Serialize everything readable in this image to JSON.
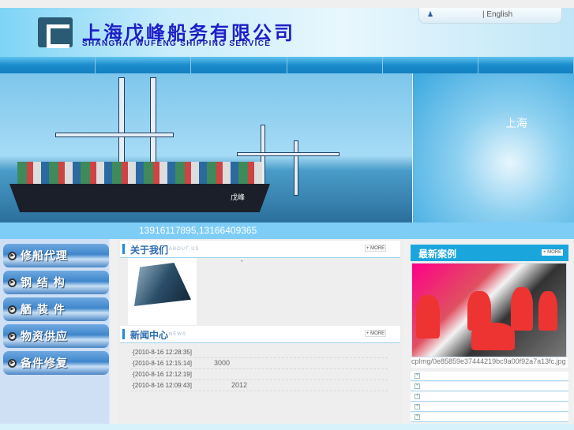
{
  "header": {
    "company_cn": "上海戊峰船务有限公司",
    "company_en": "SHANGHAI WUFENG SHIPPING SERVICE",
    "language_link": "| English",
    "user_icon": "user-icon"
  },
  "nav": {
    "items": [
      "",
      "",
      "",
      "",
      "",
      ""
    ]
  },
  "banner": {
    "ship_name": "戊峰",
    "globe_label": "上海"
  },
  "contact": {
    "phone": "13916117895,13166409365"
  },
  "sidebar": {
    "items": [
      {
        "label": "修船代理"
      },
      {
        "label": "钢 结 构"
      },
      {
        "label": "舾 装 件"
      },
      {
        "label": "物资供应"
      },
      {
        "label": "备件修复"
      }
    ]
  },
  "about": {
    "title": "关于我们",
    "subtitle": "ABOUT US",
    "more": "+ MORE",
    "text": "-"
  },
  "news": {
    "title": "新闻中心",
    "subtitle": "NEWS",
    "more": "+ MORE",
    "items": [
      {
        "time": "·[2010-8-16 12:28:35]",
        "extra": ""
      },
      {
        "time": "·[2010-8-16 12:15:14]",
        "extra": "3000"
      },
      {
        "time": "·[2010-8-16 12:12:19]",
        "extra": ""
      },
      {
        "time": "·[2010-8-16 12:09:43]",
        "extra": "2012"
      }
    ]
  },
  "cases": {
    "title": "最新案例",
    "more": "+ MORE",
    "caption": "cpImg/0e85859e37444219bc9a00f92a7a13fc.jpg",
    "items": [
      "",
      "",
      "",
      "",
      ""
    ]
  }
}
